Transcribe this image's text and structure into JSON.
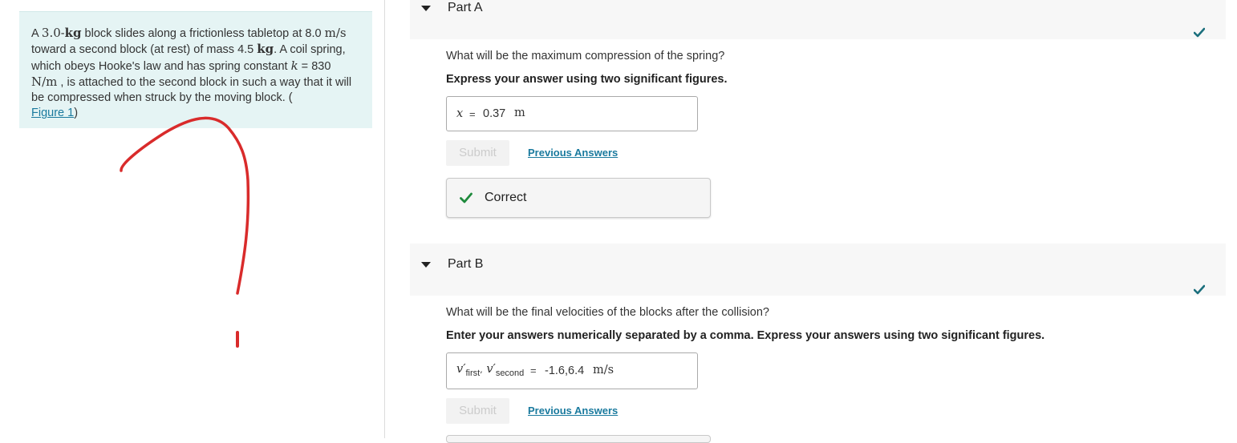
{
  "problem": {
    "t1": "A ",
    "m1": "3.0",
    "t1b": "-",
    "u1": "kg",
    "t2": " block slides along a frictionless tabletop at ",
    "m2": "8.0",
    "u2": "m/s",
    "t3": " toward a second block (at rest) of mass ",
    "m3": "4.5",
    "u3": "kg",
    "t4": ". A coil spring, which obeys Hooke's law and has spring constant ",
    "k": "k",
    "t5": " = ",
    "m4": "830",
    "u4": "N/m",
    "t6": " , is attached to the second block in such a way that it will be compressed when struck by the moving block. (",
    "figure_link": "Figure 1",
    "t7": ")"
  },
  "part_a": {
    "title": "Part A",
    "question": "What will be the maximum compression of the spring?",
    "instruction": "Express your answer using two significant figures.",
    "variable": "x",
    "equals": "=",
    "value": "0.37",
    "unit": "m",
    "submit_label": "Submit",
    "previous_answers_label": "Previous Answers",
    "feedback": "Correct"
  },
  "part_b": {
    "title": "Part B",
    "question": "What will be the final velocities of the blocks after the collision?",
    "instruction": "Enter your answers numerically separated by a comma. Express your answers using two significant figures.",
    "var1": "v′",
    "var1_sub": "first",
    "sep": ",",
    "var2": "v′",
    "var2_sub": "second",
    "equals": "=",
    "value": "-1.6,6.4",
    "unit": "m/s",
    "submit_label": "Submit",
    "previous_answers_label": "Previous Answers"
  },
  "colors": {
    "problem_bg": "#e5f4f4",
    "link": "#1a7a9e",
    "check_teal": "#1b6f7d",
    "check_green": "#1e8a3c",
    "annotation_red": "#d92b2b"
  }
}
